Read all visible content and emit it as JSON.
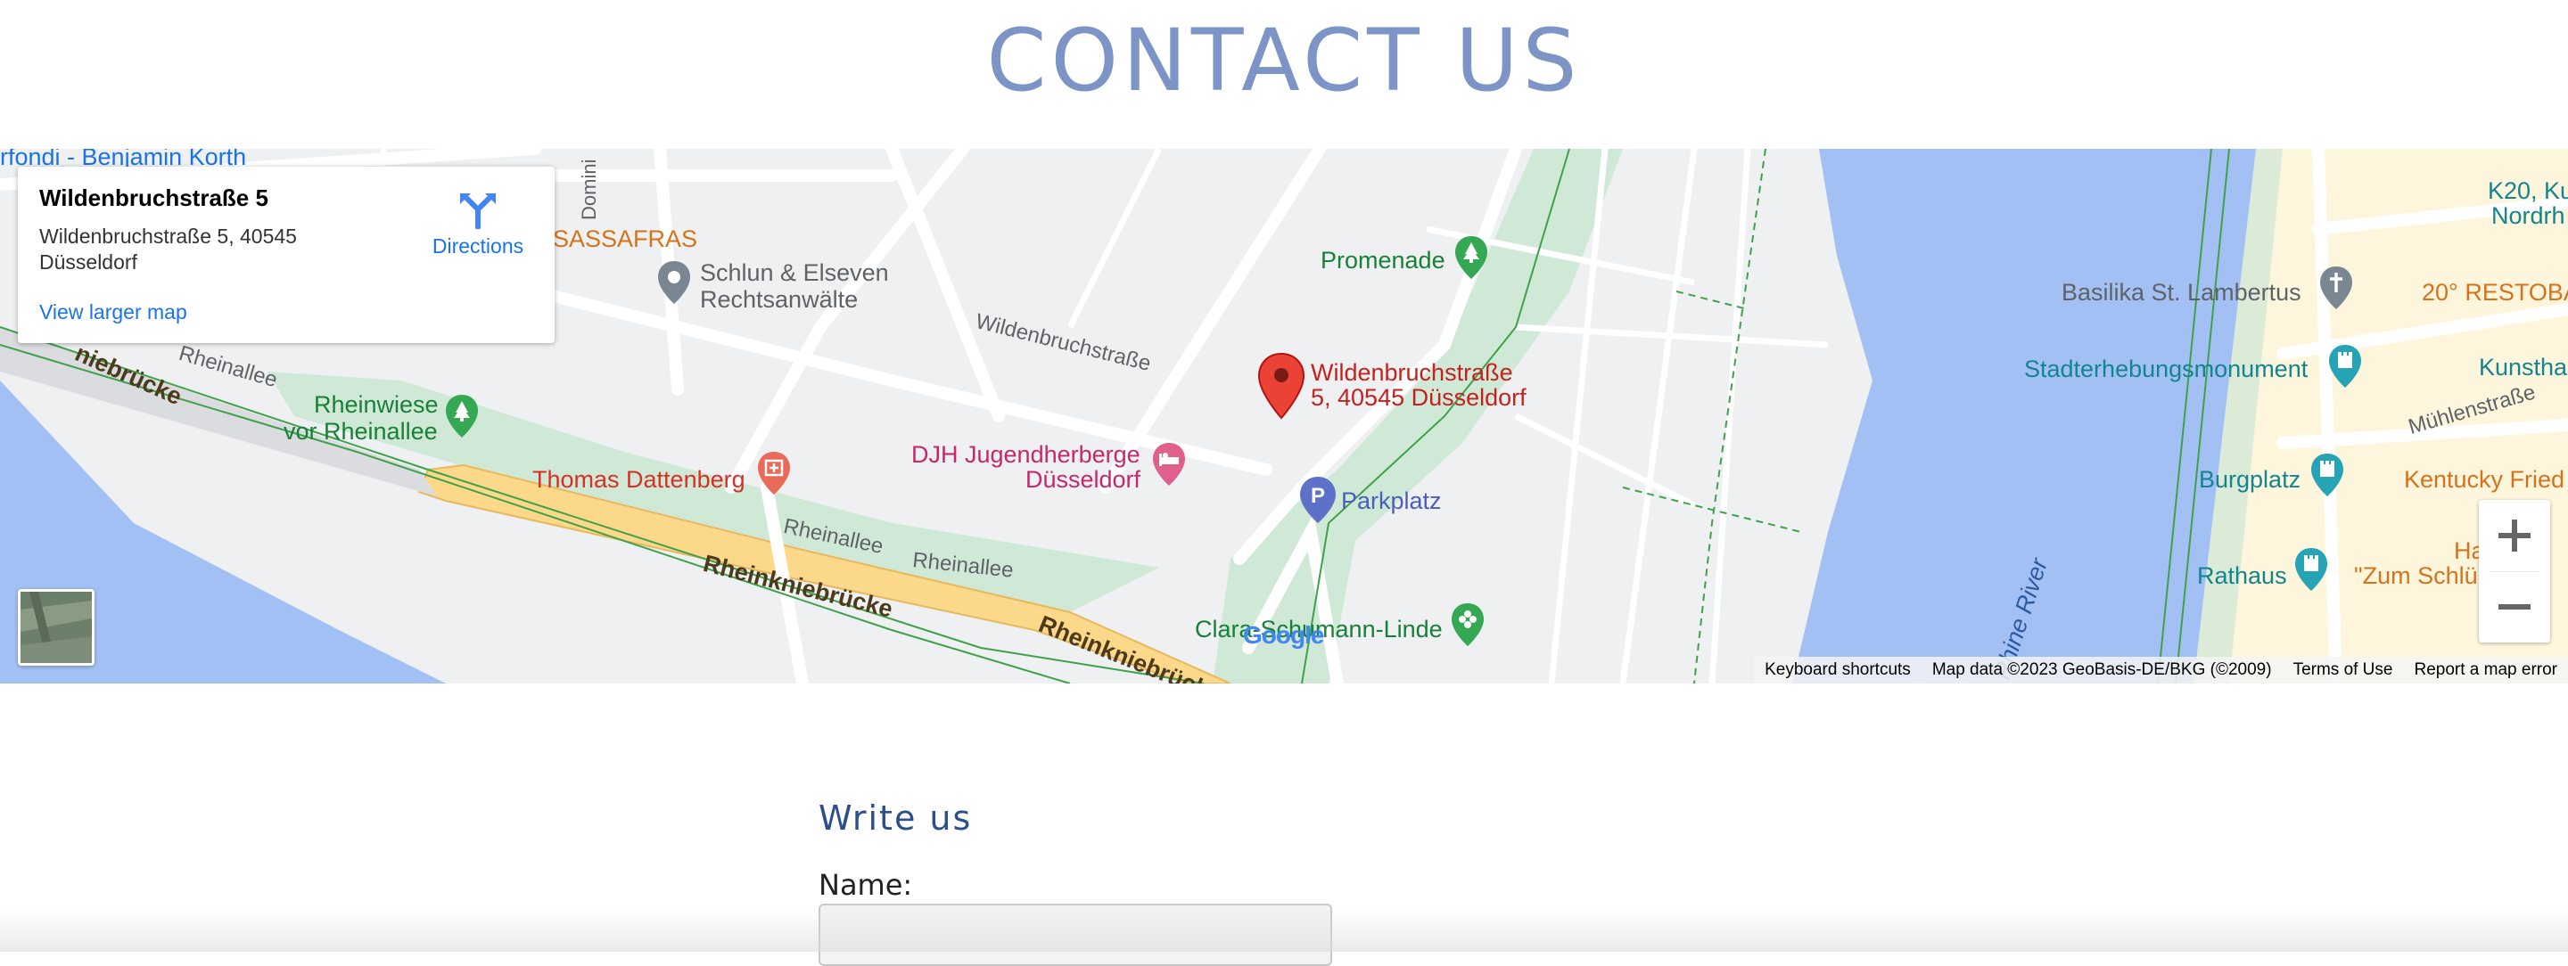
{
  "page": {
    "title": "CONTACT US"
  },
  "map": {
    "info_card": {
      "title": "Wildenbruchstraße 5",
      "address": "Wildenbruchstraße 5, 40545 Düsseldorf",
      "view_larger": "View larger map",
      "directions": "Directions"
    },
    "marker_label_line1": "Wildenbruchstraße",
    "marker_label_line2": "5, 40545 Düsseldorf",
    "places": {
      "benjamin_korth": "rfondi - Benjamin Korth",
      "sassafras": "SASSAFRAS",
      "schlun_1": "Schlun & Elseven",
      "schlun_2": "Rechtsanwälte",
      "promenade": "Promenade",
      "rheinwiese_1": "Rheinwiese",
      "rheinwiese_2": "vor Rheinallee",
      "thomas": "Thomas Dattenberg",
      "djh_1": "DJH Jugendherberge",
      "djh_2": "Düsseldorf",
      "parkplatz": "Parkplatz",
      "clara": "Clara-Schumann-Linde",
      "basilika": "Basilika St. Lambertus",
      "stadt": "Stadterhebungsmonument",
      "burgplatz": "Burgplatz",
      "rathaus": "Rathaus",
      "k20_1": "K20, Ku",
      "k20_2": "Nordrh",
      "restoba": "20° RESTOBA",
      "kunstha": "Kunstha",
      "kentucky": "Kentucky Fried",
      "hausbra_1": "Hausbra",
      "hausbra_2": "\"Zum Schlü"
    },
    "streets": {
      "wildenbruch": "Wildenbruchstraße",
      "rheinallee_1": "Rheinallee",
      "rheinallee_2": "Rheinallee",
      "rheinallee_nw": "Rheinallee",
      "rheinkniebruecke_1": "Rheinkniebrücke",
      "rheinkniebruecke_2": "Rheinkniebrücke",
      "rheinkniebruecke_nw": "niebrücke",
      "muehlenstrasse": "Mühlenstraße",
      "rhine_river": "Rhine River",
      "domini": "Domini"
    },
    "attribution": {
      "shortcuts": "Keyboard shortcuts",
      "data": "Map data ©2023 GeoBasis-DE/BKG (©2009)",
      "terms": "Terms of Use",
      "report": "Report a map error"
    },
    "google_logo": "Google",
    "colors": {
      "water": "#a3c0f4",
      "park": "#cfe9d6",
      "bridge": "#fcd88a",
      "marker": "#ea4335",
      "city": "#fdf6dd"
    }
  },
  "form": {
    "title": "Write us",
    "name_label": "Name:",
    "name_value": ""
  }
}
